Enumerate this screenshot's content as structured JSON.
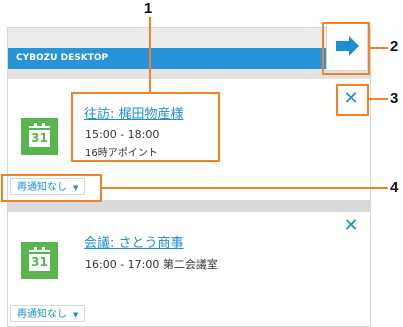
{
  "app": {
    "title": "CYBOZU DESKTOP"
  },
  "events": [
    {
      "icon_day": "31",
      "title": "往訪: 梶田物産様",
      "time": "15:00 - 18:00",
      "note": "16時アポイント",
      "snooze": "再通知なし"
    },
    {
      "icon_day": "31",
      "title": "会議: さとう商事",
      "time": "16:00 - 17:00 第二会議室",
      "snooze": "再通知なし"
    }
  ],
  "callouts": {
    "n1": "1",
    "n2": "2",
    "n3": "3",
    "n4": "4"
  },
  "icons": {
    "dismiss": "close-icon",
    "collapse": "arrow-right-icon",
    "calendar": "calendar-icon",
    "dropdown": "caret-down-icon"
  },
  "colors": {
    "accent": "#2893d8",
    "link": "#1c8fd0",
    "calendar": "#59b54d",
    "callout": "#f08228"
  }
}
